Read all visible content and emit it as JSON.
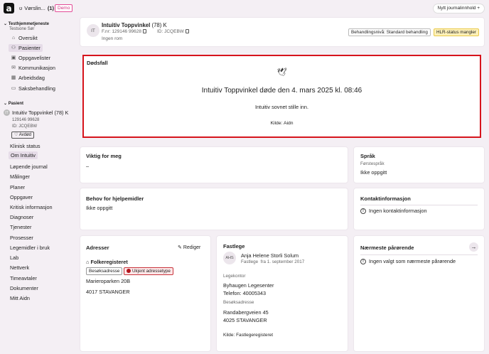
{
  "topbar": {
    "logo": "a",
    "workspace_icon": "ʊ",
    "workspace_label": "Vørslin...",
    "workspace_count": "(1)",
    "demo_badge": "Demo",
    "new_journal_label": "Nytt journalinnhold",
    "new_journal_icon": "+"
  },
  "sidebar": {
    "unit_title": "Testhjemmetjeneste",
    "unit_sub": "Testsone Sør",
    "nav": [
      {
        "label": "Oversikt",
        "icon": "⌂",
        "active": false
      },
      {
        "label": "Pasienter",
        "icon": "⚇",
        "active": true
      },
      {
        "label": "Oppgavelister",
        "icon": "▣",
        "active": false
      },
      {
        "label": "Kommunikasjon",
        "icon": "✉",
        "active": false
      },
      {
        "label": "Arbeidsdag",
        "icon": "▦",
        "active": false
      },
      {
        "label": "Saksbehandling",
        "icon": "▭",
        "active": false
      }
    ],
    "patient_section": "Pasient",
    "patient_avatar": "IT",
    "patient_name": "Intuitiv Toppvinkel (78) K",
    "patient_fnr": "129146 99628",
    "patient_id": "ID: JCQEBW",
    "avdod_label": "Avdød",
    "patient_nav": [
      {
        "label": "Klinisk status",
        "active": false
      },
      {
        "label": "Om Intuitiv",
        "active": true
      },
      {
        "label": "Løpende journal",
        "active": false
      },
      {
        "label": "Målinger",
        "active": false
      },
      {
        "label": "Planer",
        "active": false
      },
      {
        "label": "Oppgaver",
        "active": false
      },
      {
        "label": "Kritisk informasjon",
        "active": false
      },
      {
        "label": "Diagnoser",
        "active": false
      },
      {
        "label": "Tjenester",
        "active": false
      },
      {
        "label": "Prosesser",
        "active": false
      },
      {
        "label": "Legemidler i bruk",
        "active": false
      },
      {
        "label": "Lab",
        "active": false
      },
      {
        "label": "Nettverk",
        "active": false
      },
      {
        "label": "Timeavtaler",
        "active": false
      },
      {
        "label": "Dokumenter",
        "active": false
      },
      {
        "label": "Mitt Aidn",
        "active": false
      }
    ]
  },
  "header": {
    "avatar": "IT",
    "name": "Intuitiv Toppvinkel",
    "age_gender": "(78) K",
    "fnr_label": "F.nr: 129146 99628",
    "id_label": "ID: JCQEBW",
    "room": "Ingen rom",
    "level_badge": "Behandlingsnivå: Standard behandling",
    "hlr_badge": "HLR-status mangler"
  },
  "death": {
    "title": "Dødsfall",
    "icon": "🕊",
    "headline": "Intuitiv Toppvinkel døde den 4. mars 2025 kl. 08:46",
    "note": "Intuitiv sovnet stille inn.",
    "source": "Kilde: Aidn"
  },
  "important": {
    "title": "Viktig for meg",
    "value": "–"
  },
  "language": {
    "title": "Språk",
    "label": "Førstespråk",
    "value": "Ikke oppgitt"
  },
  "aids": {
    "title": "Behov for hjelpemidler",
    "value": "Ikke oppgitt"
  },
  "contact": {
    "title": "Kontaktinformasjon",
    "value": "Ingen kontaktinformasjon"
  },
  "addresses": {
    "title": "Adresser",
    "edit_label": "Rediger",
    "source_title": "Folkeregisteret",
    "tag1": "Besøksadresse",
    "tag2": "Ukjent adressetype",
    "street": "Marieroparken 20B",
    "postal": "4017 STAVANGER"
  },
  "gp": {
    "title": "Fastlege",
    "avatar": "AHS",
    "name": "Anja Helene Storli Solum",
    "role": "Fastlege",
    "since": "fra 1. september 2017",
    "office_label": "Legekontor",
    "office_name": "Byhaugen Legesenter",
    "office_phone": "Telefon: 40005343",
    "visit_label": "Besøksadresse",
    "visit_street": "Randabergveien 45",
    "visit_postal": "4025 STAVANGER",
    "source": "Kilde: Fastlegeregisteret"
  },
  "relatives": {
    "title": "Nærmeste pårørende",
    "value": "Ingen valgt som nærmeste pårørende",
    "arrow": "→"
  }
}
